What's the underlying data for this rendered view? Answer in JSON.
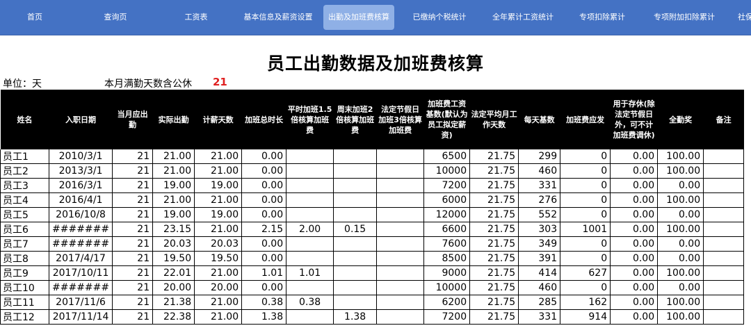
{
  "nav": {
    "items": [
      "首页",
      "查询页",
      "工资表",
      "基本信息及薪资设置",
      "出勤及加班费核算",
      "已缴纳个税统计",
      "全年累计工资统计",
      "专项扣除累计",
      "专项附加扣除累计",
      "社保"
    ],
    "active_index": 4
  },
  "page": {
    "title": "员工出勤数据及加班费核算",
    "unit_label": "单位：天",
    "full_attendance_label": "本月满勤天数含公休",
    "full_attendance_value": "21"
  },
  "table": {
    "headers": [
      "姓名",
      "入职日期",
      "当月应出勤",
      "实际出勤",
      "计薪天数",
      "加班总时长",
      "平时加班1.5倍核算加班费",
      "周末加班2倍核算加班费",
      "法定节假日加班3倍核算加班费",
      "加班费工资基数(默认为员工拟定薪资)",
      "法定平均月工作天数",
      "每天基数",
      "加班费应发",
      "用于存休(除法定节假日外，可不计加班费调休)",
      "全勤奖",
      "备注"
    ],
    "rows": [
      [
        "员工1",
        "2010/3/1",
        "21",
        "21.00",
        "21.00",
        "0.00",
        "",
        "",
        "",
        "6500",
        "21.75",
        "299",
        "0",
        "0.00",
        "100.00",
        ""
      ],
      [
        "员工2",
        "2013/3/1",
        "21",
        "21.00",
        "21.00",
        "0.00",
        "",
        "",
        "",
        "10000",
        "21.75",
        "460",
        "0",
        "0.00",
        "100.00",
        ""
      ],
      [
        "员工3",
        "2016/3/1",
        "21",
        "19.00",
        "19.00",
        "0.00",
        "",
        "",
        "",
        "7200",
        "21.75",
        "331",
        "0",
        "0.00",
        "0.00",
        ""
      ],
      [
        "员工4",
        "2016/4/1",
        "21",
        "21.00",
        "21.00",
        "0.00",
        "",
        "",
        "",
        "6000",
        "21.75",
        "276",
        "0",
        "0.00",
        "100.00",
        ""
      ],
      [
        "员工5",
        "2016/10/8",
        "21",
        "19.00",
        "19.00",
        "0.00",
        "",
        "",
        "",
        "12000",
        "21.75",
        "552",
        "0",
        "0.00",
        "0.00",
        ""
      ],
      [
        "员工6",
        "#######",
        "21",
        "23.15",
        "21.00",
        "2.15",
        "2.00",
        "0.15",
        "",
        "6600",
        "21.75",
        "303",
        "1001",
        "0.00",
        "100.00",
        ""
      ],
      [
        "员工7",
        "#######",
        "21",
        "20.03",
        "20.03",
        "0.00",
        "",
        "",
        "",
        "7600",
        "21.75",
        "349",
        "0",
        "0.00",
        "0.00",
        ""
      ],
      [
        "员工8",
        "2017/4/17",
        "21",
        "19.50",
        "19.50",
        "0.00",
        "",
        "",
        "",
        "8500",
        "21.75",
        "391",
        "0",
        "0.00",
        "0.00",
        ""
      ],
      [
        "员工9",
        "2017/10/11",
        "21",
        "22.01",
        "21.00",
        "1.01",
        "1.01",
        "",
        "",
        "9000",
        "21.75",
        "414",
        "627",
        "0.00",
        "100.00",
        ""
      ],
      [
        "员工10",
        "#######",
        "21",
        "20.00",
        "20.00",
        "0.00",
        "",
        "",
        "",
        "10000",
        "21.75",
        "460",
        "0",
        "0.00",
        "0.00",
        ""
      ],
      [
        "员工11",
        "2017/11/6",
        "21",
        "21.38",
        "21.00",
        "0.38",
        "0.38",
        "",
        "",
        "6200",
        "21.75",
        "285",
        "162",
        "0.00",
        "100.00",
        ""
      ],
      [
        "员工12",
        "2017/11/14",
        "21",
        "22.38",
        "21.00",
        "1.38",
        "",
        "1.38",
        "",
        "7200",
        "21.75",
        "331",
        "914",
        "0.00",
        "100.00",
        ""
      ]
    ]
  }
}
